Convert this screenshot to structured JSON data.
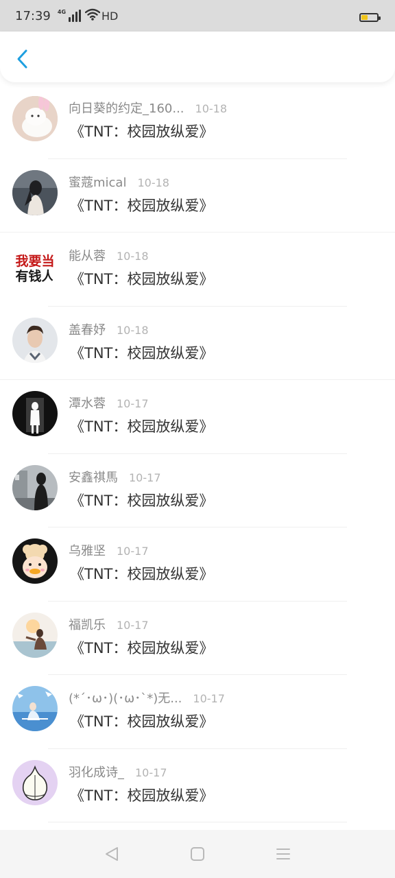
{
  "status_bar": {
    "time": "17:39",
    "network": "4G",
    "hd": "HD",
    "battery_level": 0.3,
    "battery_color": "#f0c419"
  },
  "header": {
    "back_icon": "chevron-left-icon",
    "accent_color": "#1e9fe0"
  },
  "list": {
    "items": [
      {
        "name": "向日葵的约定_160...",
        "date": "10-18",
        "title": "《TNT：校园放纵爱》",
        "avatar": "white-cat-bunny-ears"
      },
      {
        "name": "蜜蔻mical",
        "date": "10-18",
        "title": "《TNT：校园放纵爱》",
        "avatar": "girl-by-sea"
      },
      {
        "name": "能从蓉",
        "date": "10-18",
        "title": "《TNT：校园放纵爱》",
        "avatar": "red-text-我要当有钱人"
      },
      {
        "name": "盖春妤",
        "date": "10-18",
        "title": "《TNT：校园放纵爱》",
        "avatar": "young-man-portrait"
      },
      {
        "name": "潭水蓉",
        "date": "10-17",
        "title": "《TNT：校园放纵爱》",
        "avatar": "dark-silhouette"
      },
      {
        "name": "安鑫祺馬",
        "date": "10-17",
        "title": "《TNT：校园放纵爱》",
        "avatar": "street-figure"
      },
      {
        "name": "乌雅坚",
        "date": "10-17",
        "title": "《TNT：校园放纵爱》",
        "avatar": "cartoon-duck"
      },
      {
        "name": "福凯乐",
        "date": "10-17",
        "title": "《TNT：校园放纵爱》",
        "avatar": "sunset-girl"
      },
      {
        "name": "(*´･ω･)(･ω･`*)无...",
        "date": "10-17",
        "title": "《TNT：校园放纵爱》",
        "avatar": "anime-blue-sky"
      },
      {
        "name": "羽化成诗_",
        "date": "10-17",
        "title": "《TNT：校园放纵爱》",
        "avatar": "garlic-cartoon"
      }
    ]
  },
  "avatar_text": {
    "line1": "我要当",
    "line2": "有钱人"
  },
  "nav_bar": {
    "back": "triangle-back-icon",
    "home": "square-home-icon",
    "menu": "menu-lines-icon"
  }
}
